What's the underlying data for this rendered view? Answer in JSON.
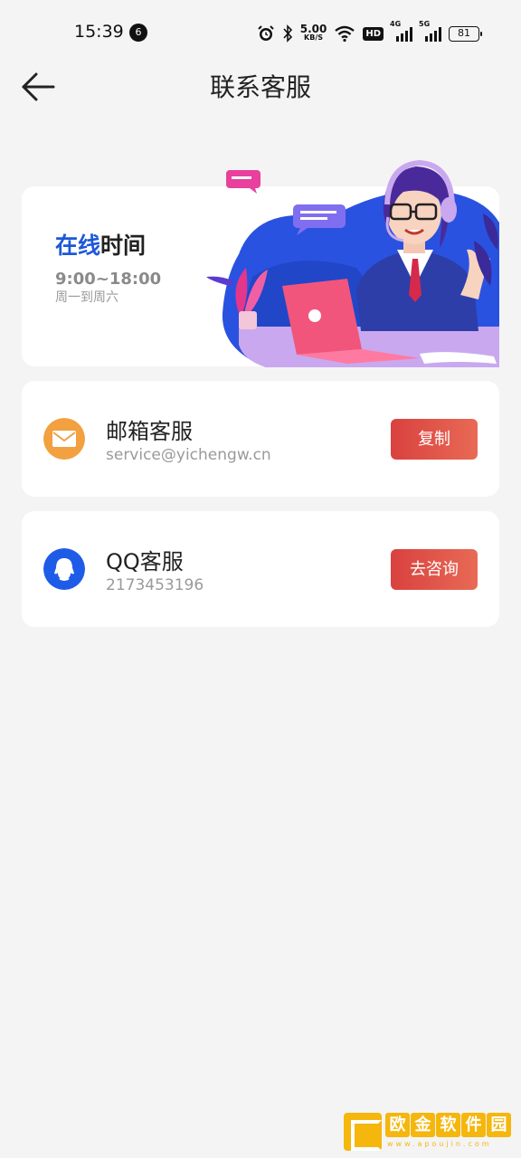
{
  "status_bar": {
    "time": "15:39",
    "notification_count": "6",
    "net_speed_value": "5.00",
    "net_speed_unit": "KB/S",
    "hd_label": "HD",
    "signal1_label": "4G",
    "signal2_label": "5G",
    "battery": "81"
  },
  "header": {
    "title": "联系客服",
    "back_icon": "arrow-left-icon"
  },
  "banner": {
    "title_accent": "在线",
    "title_rest": "时间",
    "hours": "9:00~18:00",
    "days": "周一到周六"
  },
  "contacts": [
    {
      "title": "邮箱客服",
      "value": "service@yichengw.cn",
      "button": "复制",
      "icon": "mail-icon",
      "icon_color": "#f2a040"
    },
    {
      "title": "QQ客服",
      "value": "2173453196",
      "button": "去咨询",
      "icon": "qq-icon",
      "icon_color": "#1e5ce8"
    }
  ],
  "watermark": {
    "chars": [
      "欧",
      "金",
      "软",
      "件",
      "园"
    ],
    "url": "www.apoujin.com"
  },
  "colors": {
    "accent_blue": "#1d58d8",
    "button_red": "#e05248",
    "background": "#f4f4f4"
  }
}
